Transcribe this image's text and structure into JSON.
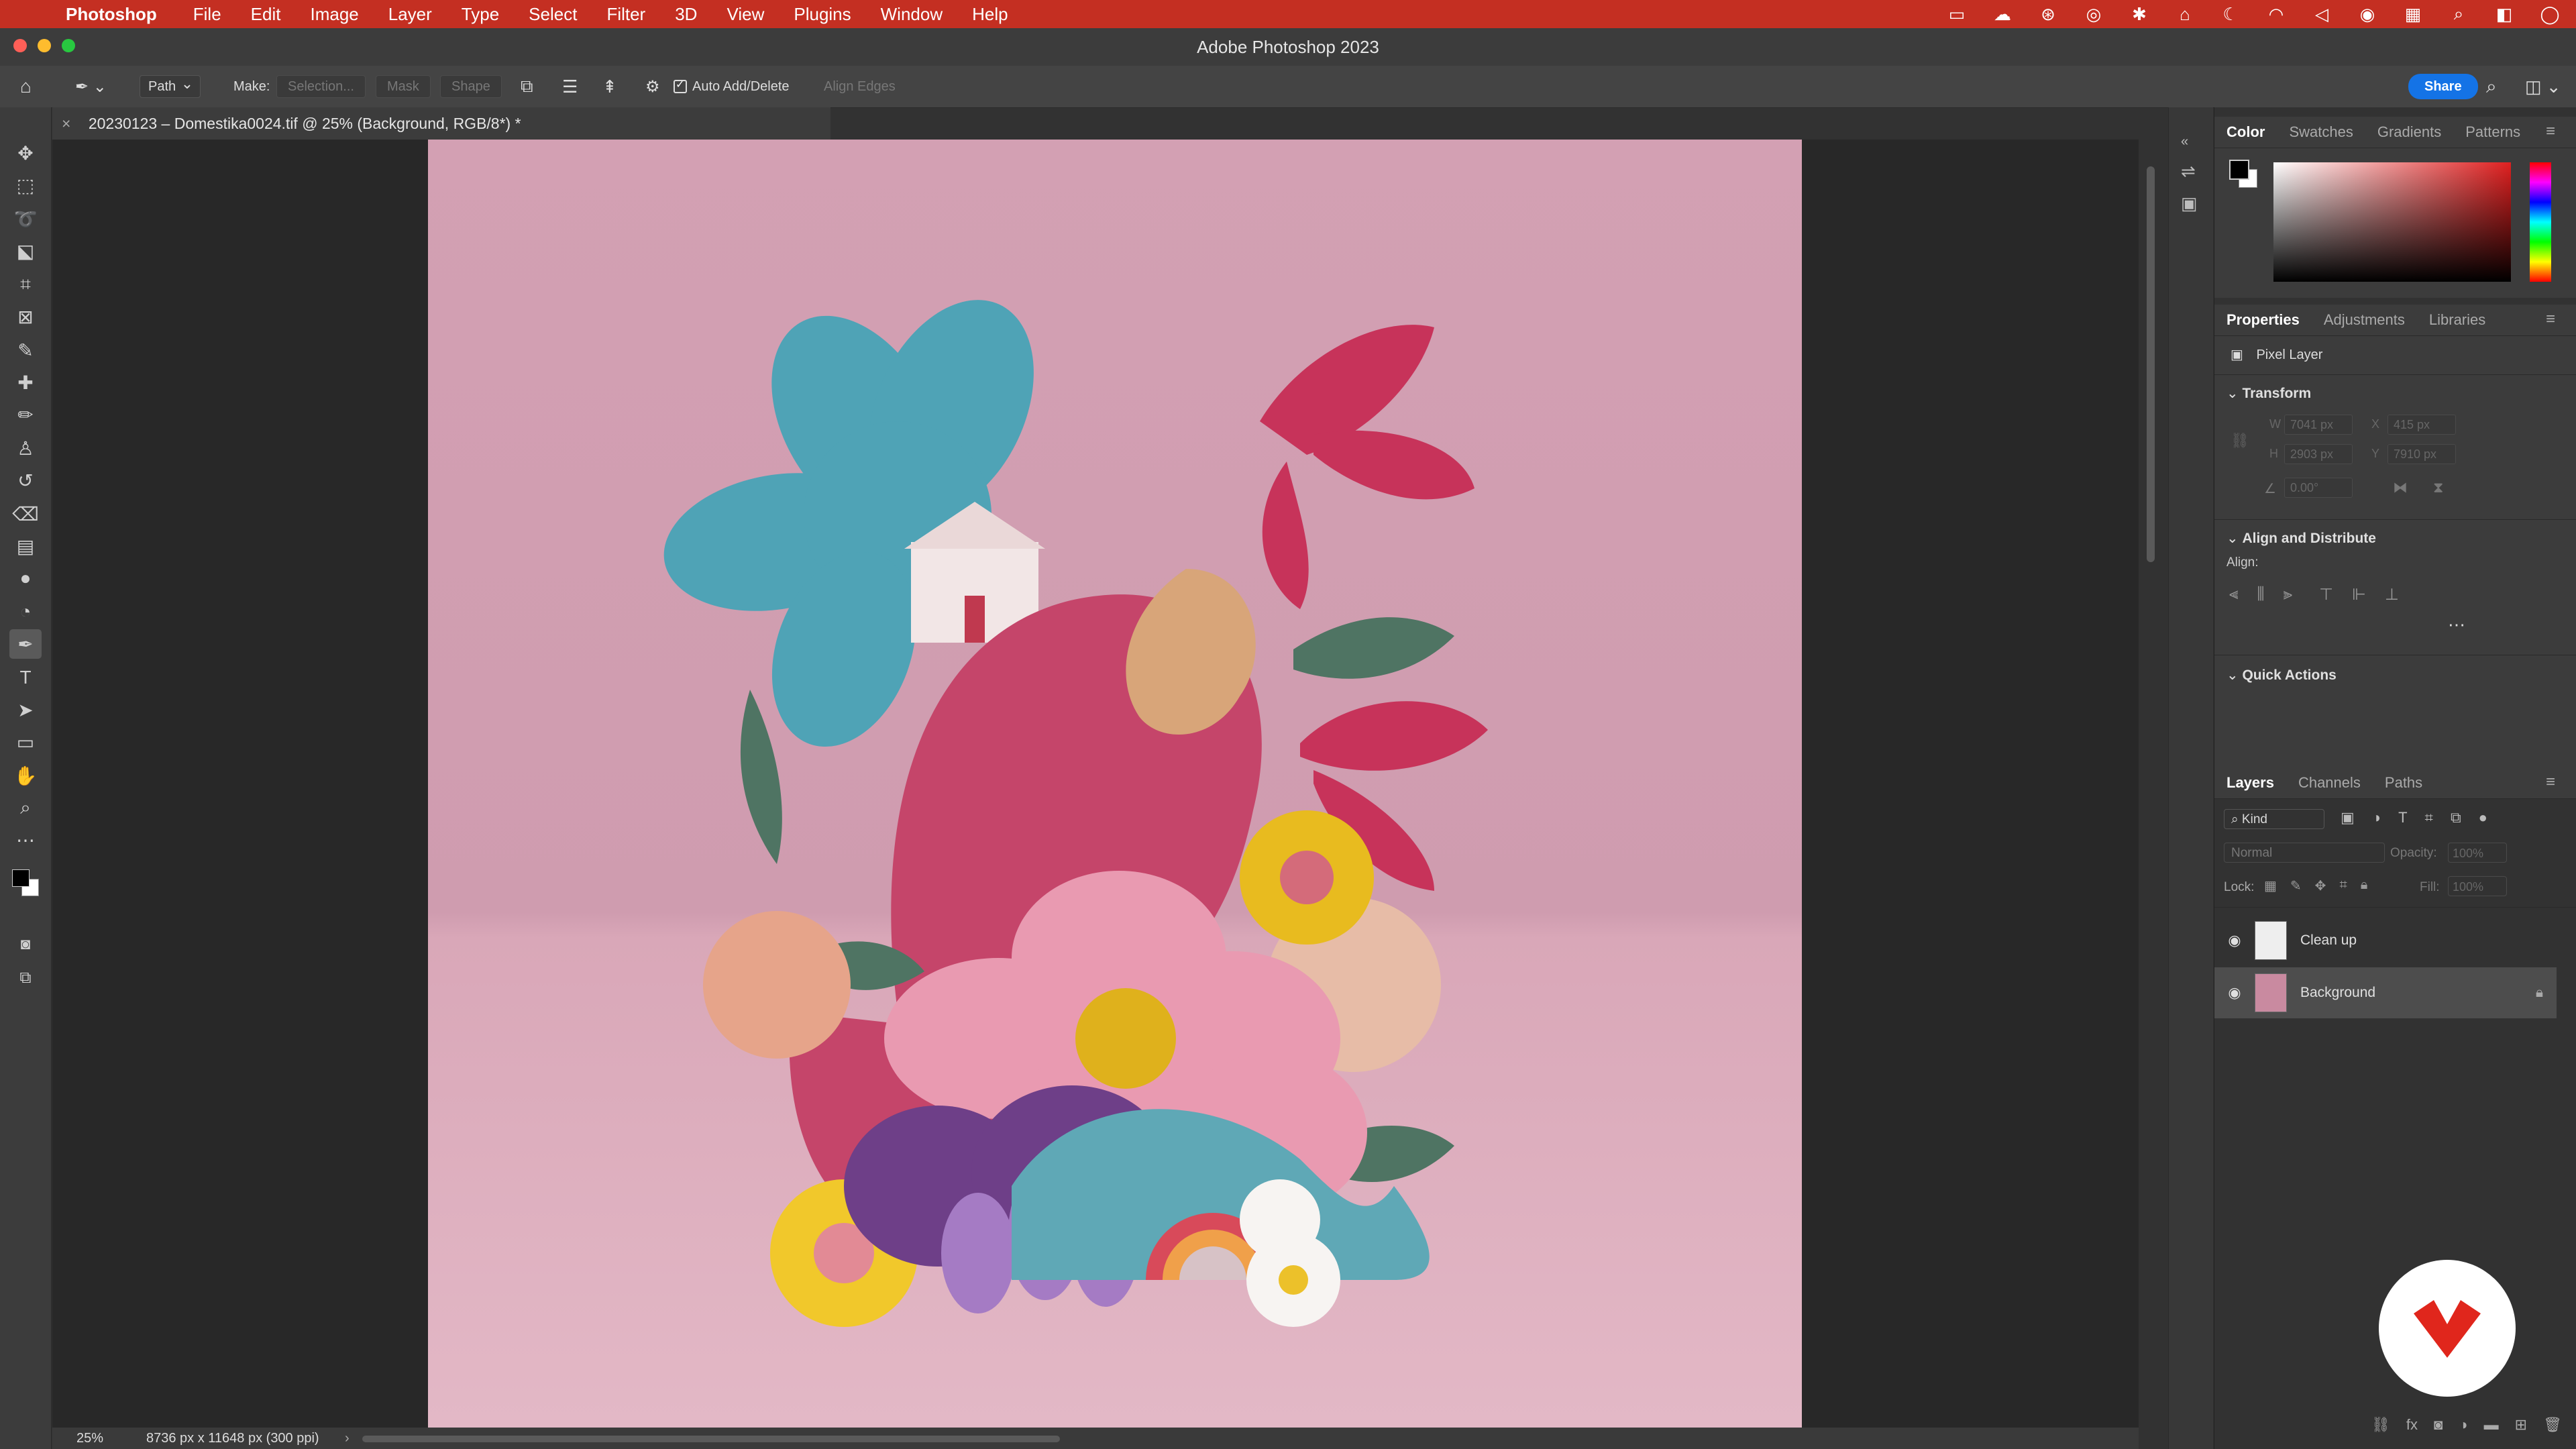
{
  "menubar": {
    "app_name": "Photoshop",
    "items": [
      "File",
      "Edit",
      "Image",
      "Layer",
      "Type",
      "Select",
      "Filter",
      "3D",
      "View",
      "Plugins",
      "Window",
      "Help"
    ]
  },
  "window": {
    "title": "Adobe Photoshop 2023"
  },
  "options": {
    "mode_value": "Path",
    "make_label": "Make:",
    "selection_label": "Selection...",
    "mask_label": "Mask",
    "shape_label": "Shape",
    "auto_add_delete_label": "Auto Add/Delete",
    "align_edges_label": "Align Edges",
    "share_label": "Share"
  },
  "document": {
    "tab_title": "20230123 – Domestika0024.tif @ 25% (Background, RGB/8*) *"
  },
  "status": {
    "zoom": "25%",
    "dimensions": "8736 px x 11648 px (300 ppi)"
  },
  "color_panel": {
    "tabs": [
      "Color",
      "Swatches",
      "Gradients",
      "Patterns"
    ]
  },
  "properties_panel": {
    "tabs": [
      "Properties",
      "Adjustments",
      "Libraries"
    ],
    "layer_type": "Pixel Layer",
    "transform_title": "Transform",
    "w_label": "W",
    "w_value": "7041 px",
    "x_label": "X",
    "x_value": "415 px",
    "h_label": "H",
    "h_value": "2903 px",
    "y_label": "Y",
    "y_value": "7910 px",
    "angle_value": "0.00°",
    "align_title": "Align and Distribute",
    "align_label": "Align:",
    "quick_actions_title": "Quick Actions"
  },
  "layers_panel": {
    "tabs": [
      "Layers",
      "Channels",
      "Paths"
    ],
    "kind_filter": "Kind",
    "blend_mode": "Normal",
    "opacity_label": "Opacity:",
    "opacity_value": "100%",
    "lock_label": "Lock:",
    "fill_label": "Fill:",
    "fill_value": "100%",
    "layers": [
      {
        "name": "Clean up"
      },
      {
        "name": "Background"
      }
    ]
  },
  "colors": {
    "menubar": "#c42f22",
    "accent": "#1473e6",
    "canvas_bg": "#d3a0b3"
  }
}
